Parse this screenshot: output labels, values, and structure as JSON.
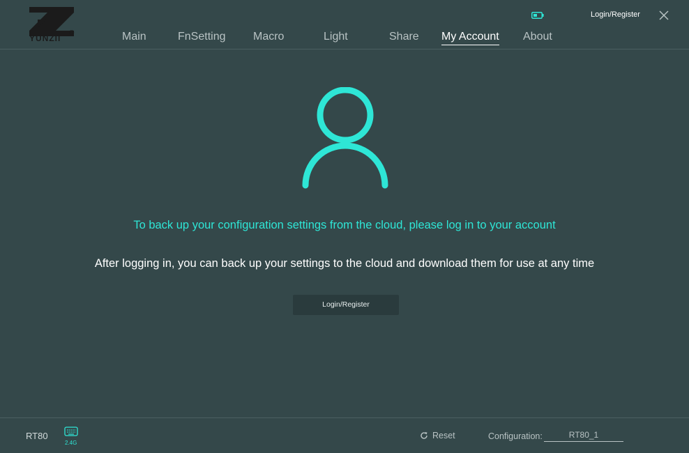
{
  "brand": {
    "logo_text": "YUNZII",
    "registered_mark": "®"
  },
  "header": {
    "nav": [
      "Main",
      "FnSetting",
      "Macro",
      "Light",
      "Share",
      "My Account",
      "About"
    ],
    "active_tab": "My Account",
    "login_register": "Login/Register",
    "battery_icon": "battery-icon",
    "close_icon": "close-icon"
  },
  "account": {
    "avatar_icon": "user-icon",
    "headline": "To back up your configuration settings from the cloud, please log in to your account",
    "subline": "After logging in, you can back up your settings to the cloud and download them for use at any time",
    "login_button": "Login/Register"
  },
  "footer": {
    "device_name": "RT80",
    "connection_icon": "keyboard-icon",
    "connection_label": "2.4G",
    "reset_label": "Reset",
    "configuration_label": "Configuration:",
    "configuration_value": "RT80_1"
  },
  "colors": {
    "background": "#34484a",
    "accent": "#2ee6d6",
    "text": "#ffffff",
    "muted_text": "#b9c3c4",
    "button_bg": "#2a3b3d"
  }
}
